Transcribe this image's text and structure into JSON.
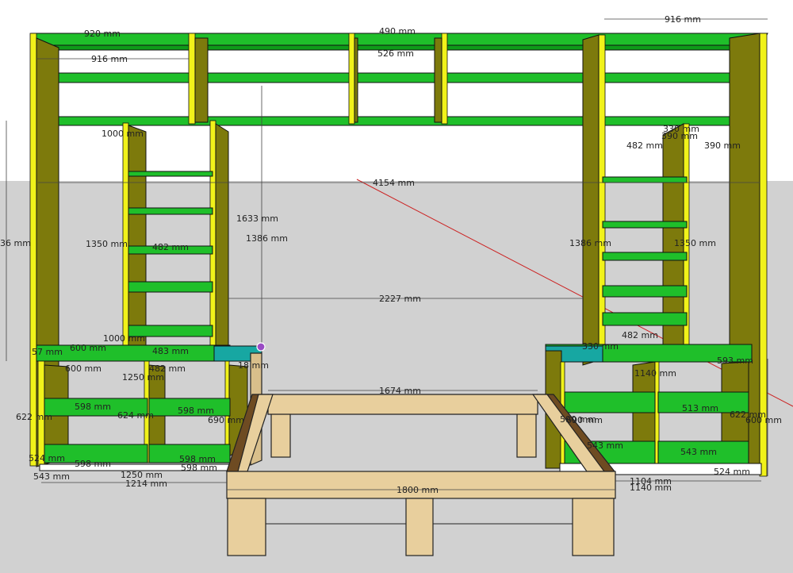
{
  "colors": {
    "sky": "#ffffff",
    "ground": "#d1d1d1",
    "shelf": "#0e9b18",
    "shelf_top": "#1fbf2a",
    "side_panel": "#7d7a0c",
    "edge": "#f1f21a",
    "bed_wood": "#e8cf9d",
    "bed_inner": "#6e4b22",
    "desk_teal": "#17a7a2",
    "axis_red": "#cc2222",
    "cursor_dot": "#9a4cc4"
  },
  "dimensions": {
    "top_right_width": "916 mm",
    "top_left_width": "916 mm",
    "top_left_overlap": "920 mm",
    "top_mid_490": "490 mm",
    "top_mid_526": "526 mm",
    "span_1000_top": "1000 mm",
    "span_4154": "4154 mm",
    "height_1633": "1633 mm",
    "height_1386": "1386 mm",
    "left_height_partial": "36 mm",
    "left_tower_height": "1350 mm",
    "left_tower_label_2": "1386 mm",
    "left_tower_shelf": "482 mm",
    "right_tower_height_1": "1386 mm",
    "right_tower_height_2": "1350 mm",
    "right_482_top": "482 mm",
    "right_390_top": "390 mm",
    "right_390_b": "390 mm",
    "right_330": "330 mm",
    "right_482_low": "482 mm",
    "gap_2227": "2227 mm",
    "left_1000": "1000 mm",
    "left_600": "600 mm",
    "left_600b": "600 mm",
    "left_483": "483 mm",
    "left_482": "482 mm",
    "left_1250": "1250 mm",
    "left_1250b": "1250 mm",
    "left_1214": "1214 mm",
    "left_622": "622 mm",
    "left_598_1": "598 mm",
    "left_598_2": "598 mm",
    "left_598_3": "598 mm",
    "left_598_4": "598 mm",
    "left_598_5": "598 mm",
    "left_624": "624 mm",
    "left_690": "690 mm",
    "left_524": "524 mm",
    "left_543": "543 mm",
    "left_57": "57 mm",
    "left_18": "18 mm",
    "bed_1674": "1674 mm",
    "bed_1800": "1800 mm",
    "right_1140": "1140 mm",
    "right_1140b": "1140 mm",
    "right_1104": "1104 mm",
    "right_590": "590 mm",
    "right_622": "622 mm",
    "right_690": "690 mm",
    "right_543": "543 mm",
    "right_543b": "543 mm",
    "right_524": "524 mm",
    "right_513": "513 mm",
    "right_593": "593 mm",
    "right_330b": "330 mm",
    "right_600": "600 mm"
  }
}
